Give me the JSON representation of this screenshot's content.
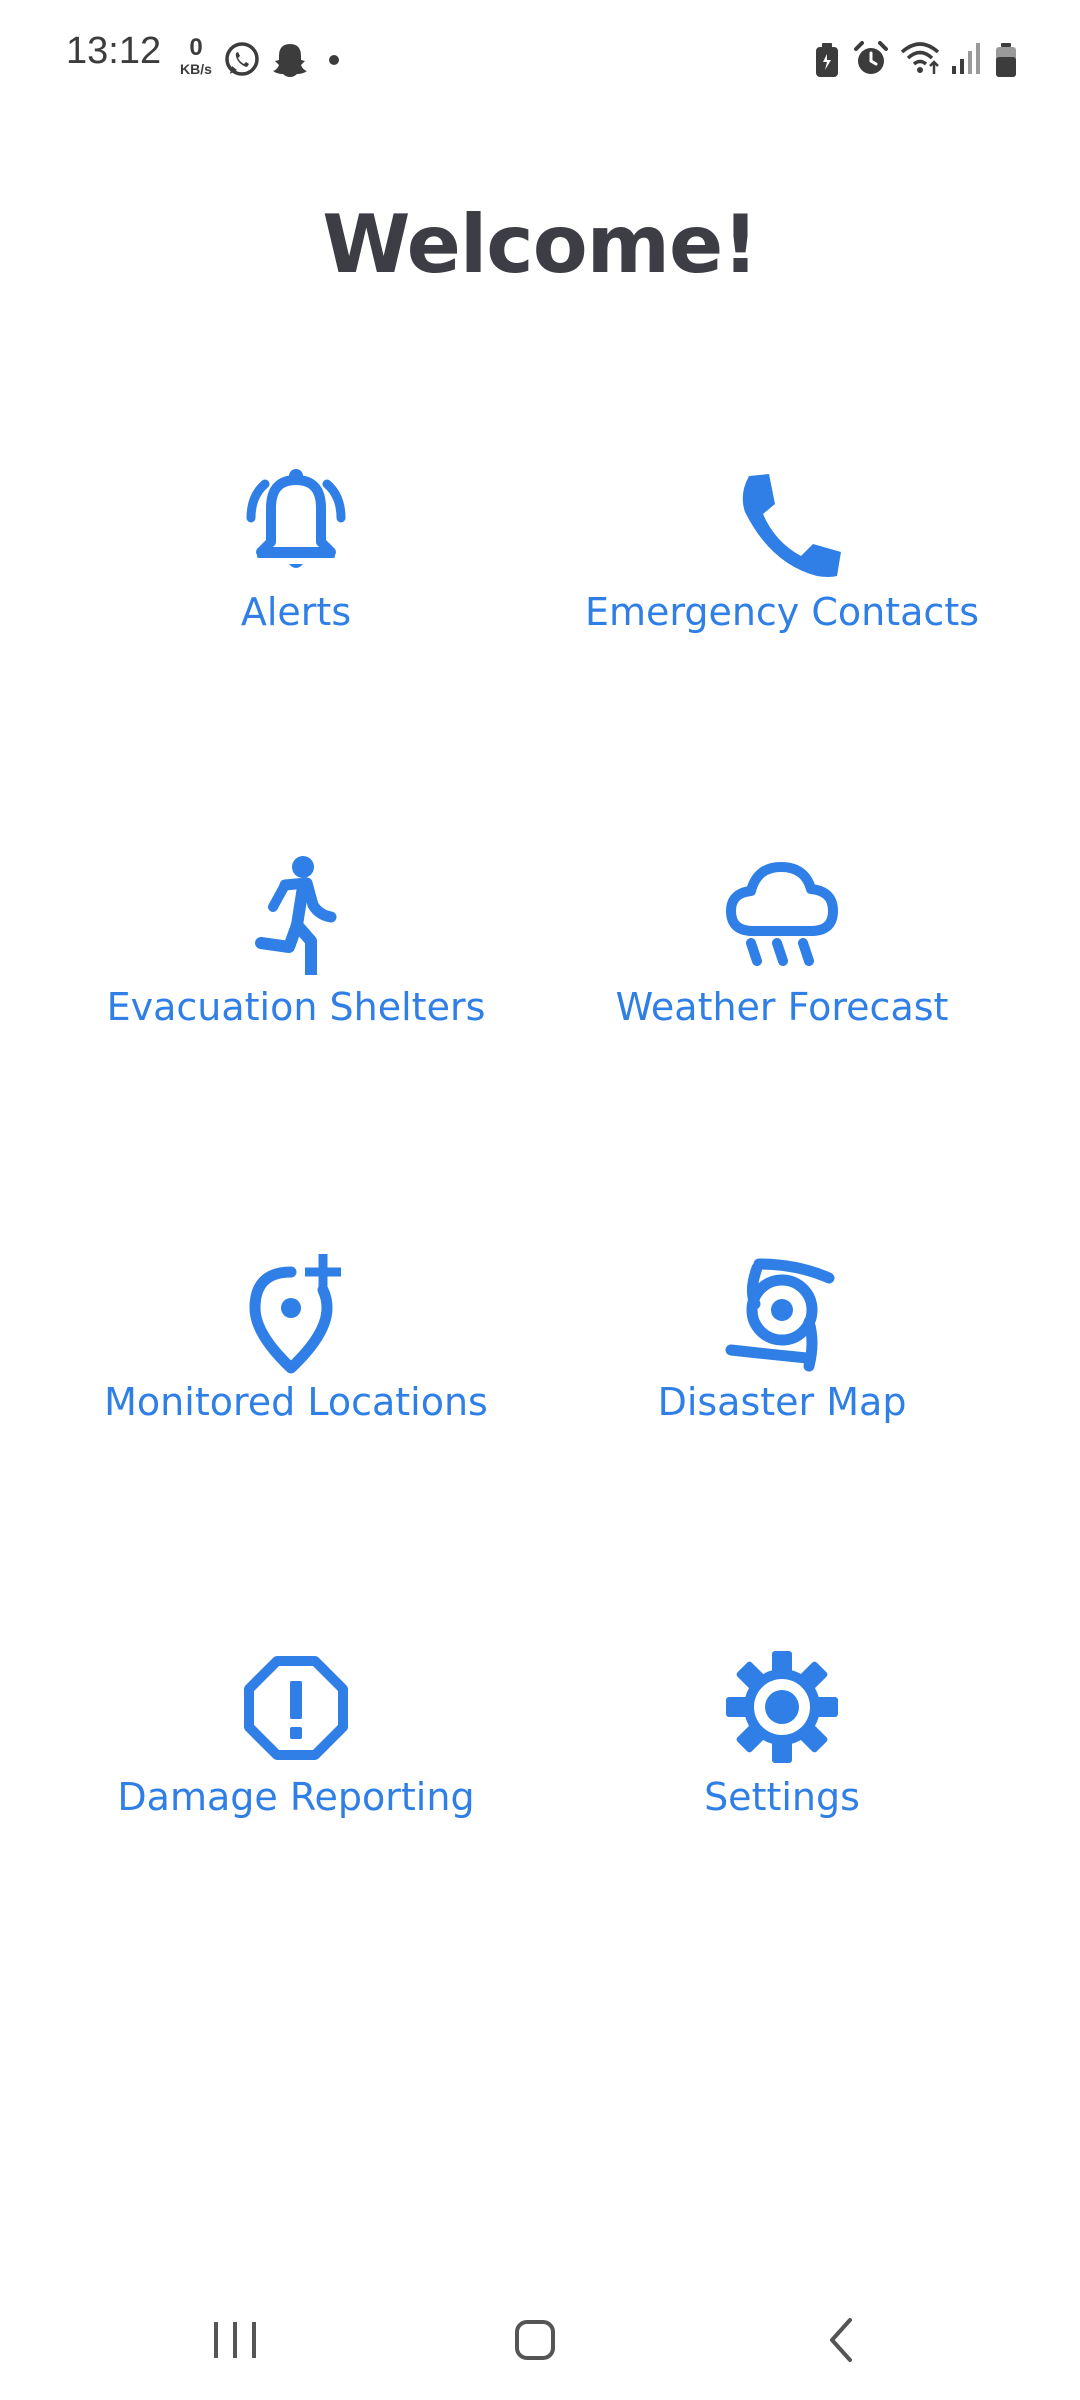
{
  "status_bar": {
    "time": "13:12",
    "net_speed_value": "0",
    "net_speed_unit": "KB/s",
    "left_icons": [
      "whatsapp-icon",
      "snapchat-icon",
      "dot-icon"
    ],
    "right_icons": [
      "battery-saver-icon",
      "alarm-icon",
      "wifi-icon",
      "signal-icon",
      "battery-icon"
    ]
  },
  "header": {
    "title": "Welcome!"
  },
  "menu": {
    "items": [
      {
        "label": "Alerts",
        "icon": "bell-alert-icon"
      },
      {
        "label": "Emergency Contacts",
        "icon": "phone-icon"
      },
      {
        "label": "Evacuation Shelters",
        "icon": "running-person-icon"
      },
      {
        "label": "Weather Forecast",
        "icon": "rain-cloud-icon"
      },
      {
        "label": "Monitored Locations",
        "icon": "add-location-icon"
      },
      {
        "label": "Disaster Map",
        "icon": "cyclone-icon"
      },
      {
        "label": "Damage Reporting",
        "icon": "report-octagon-icon"
      },
      {
        "label": "Settings",
        "icon": "gear-icon"
      }
    ]
  },
  "colors": {
    "accent": "#2f7fe6",
    "title": "#3d3d45",
    "status_text": "#3c3c3c",
    "background": "#ffffff"
  },
  "nav_bar": {
    "buttons": [
      "recents-icon",
      "home-icon",
      "back-icon"
    ]
  }
}
